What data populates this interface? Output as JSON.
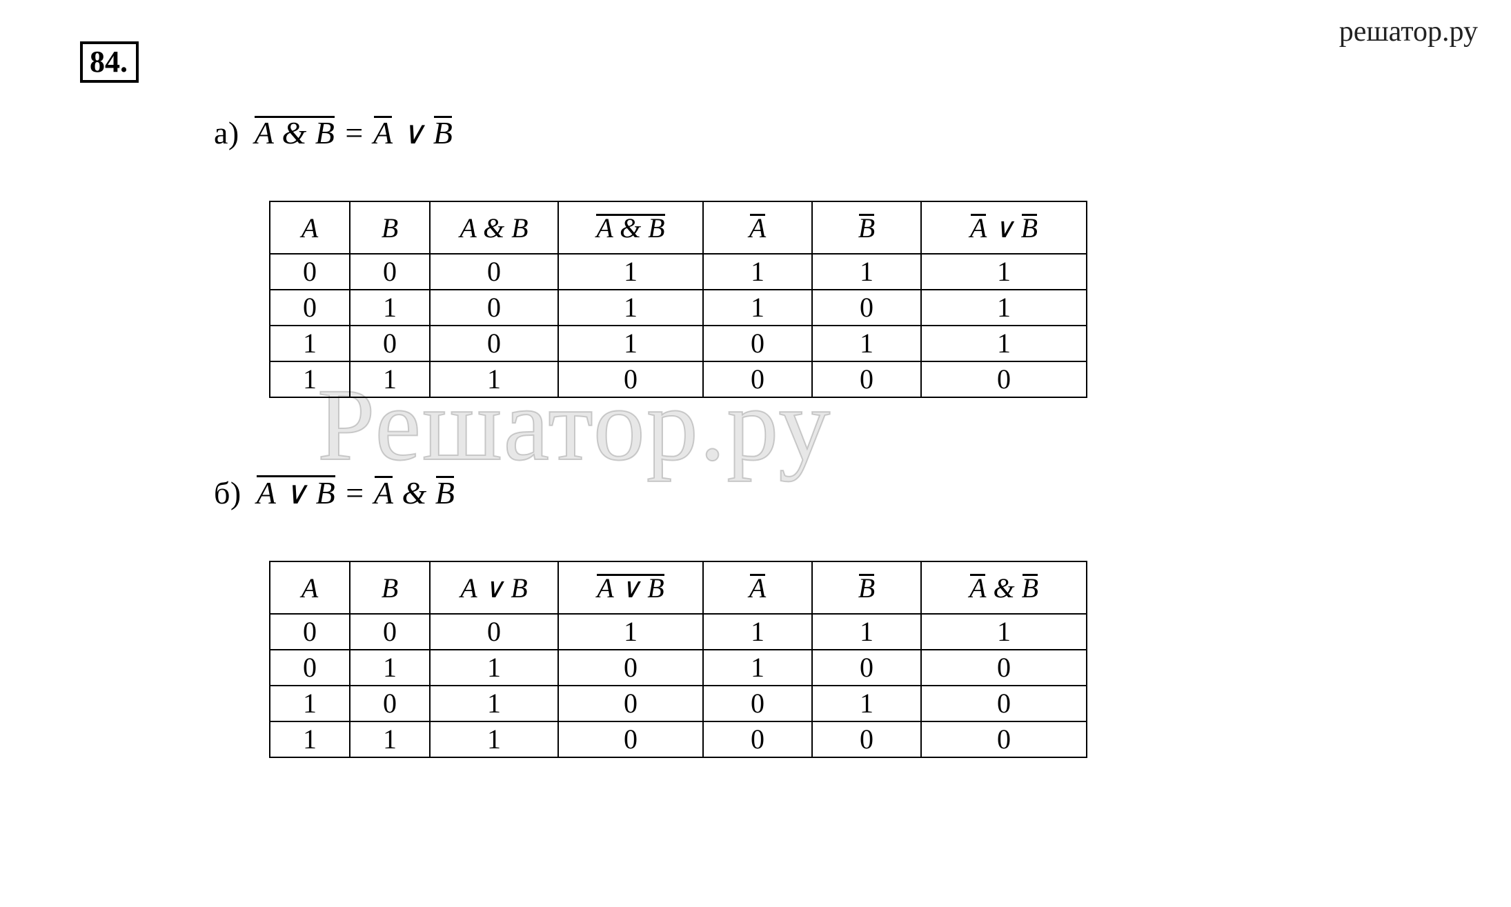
{
  "site_watermark": "решатор.ру",
  "big_watermark": "Решатор.ру",
  "problem_number": "84.",
  "section_a": {
    "label": "а)",
    "lhs_overline": "A & B",
    "eq": " = ",
    "rhs_A": "A",
    "rhs_join": "  ∨  ",
    "rhs_B": "B",
    "headers": {
      "A": "A",
      "B": "B",
      "AB": "A & B",
      "nAB": "A & B",
      "nA": "A",
      "nB": "B",
      "final_A": "A",
      "final_join": "  ∨  ",
      "final_B": "B"
    },
    "rows": [
      {
        "A": "0",
        "B": "0",
        "AB": "0",
        "nAB": "1",
        "nA": "1",
        "nB": "1",
        "final": "1"
      },
      {
        "A": "0",
        "B": "1",
        "AB": "0",
        "nAB": "1",
        "nA": "1",
        "nB": "0",
        "final": "1"
      },
      {
        "A": "1",
        "B": "0",
        "AB": "0",
        "nAB": "1",
        "nA": "0",
        "nB": "1",
        "final": "1"
      },
      {
        "A": "1",
        "B": "1",
        "AB": "1",
        "nAB": "0",
        "nA": "0",
        "nB": "0",
        "final": "0"
      }
    ]
  },
  "section_b": {
    "label": "б)",
    "lhs_overline": "A ∨ B",
    "eq": " = ",
    "rhs_A": "A",
    "rhs_join": " & ",
    "rhs_B": "B",
    "headers": {
      "A": "A",
      "B": "B",
      "AB": "A ∨ B",
      "nAB": "A ∨ B",
      "nA": "A",
      "nB": "B",
      "final_A": "A",
      "final_join": " & ",
      "final_B": "B"
    },
    "rows": [
      {
        "A": "0",
        "B": "0",
        "AB": "0",
        "nAB": "1",
        "nA": "1",
        "nB": "1",
        "final": "1"
      },
      {
        "A": "0",
        "B": "1",
        "AB": "1",
        "nAB": "0",
        "nA": "1",
        "nB": "0",
        "final": "0"
      },
      {
        "A": "1",
        "B": "0",
        "AB": "1",
        "nAB": "0",
        "nA": "0",
        "nB": "1",
        "final": "0"
      },
      {
        "A": "1",
        "B": "1",
        "AB": "1",
        "nAB": "0",
        "nA": "0",
        "nB": "0",
        "final": "0"
      }
    ]
  }
}
